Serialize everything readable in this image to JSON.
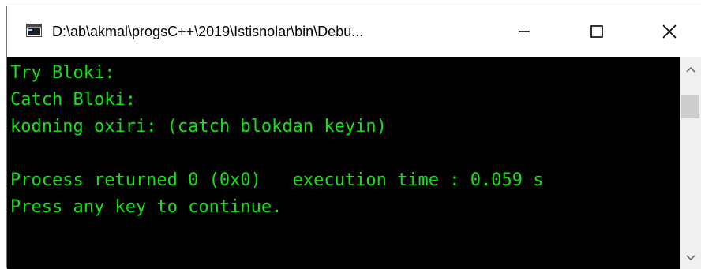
{
  "window": {
    "title": "D:\\ab\\akmal\\progsC++\\2019\\Istisnolar\\bin\\Debu..."
  },
  "console": {
    "lines": [
      "Try Bloki:",
      "Catch Bloki:",
      "kodning oxiri: (catch blokdan keyin)",
      "",
      "Process returned 0 (0x0)   execution time : 0.059 s",
      "Press any key to continue."
    ]
  },
  "colors": {
    "console_text": "#13e313",
    "console_bg": "#000000",
    "titlebar_bg": "#ffffff"
  },
  "icons": {
    "app": "console-window-icon",
    "minimize": "minimize-icon",
    "maximize": "maximize-icon",
    "close": "close-icon",
    "scroll_up": "chevron-up-icon",
    "scroll_down": "chevron-down-icon"
  }
}
